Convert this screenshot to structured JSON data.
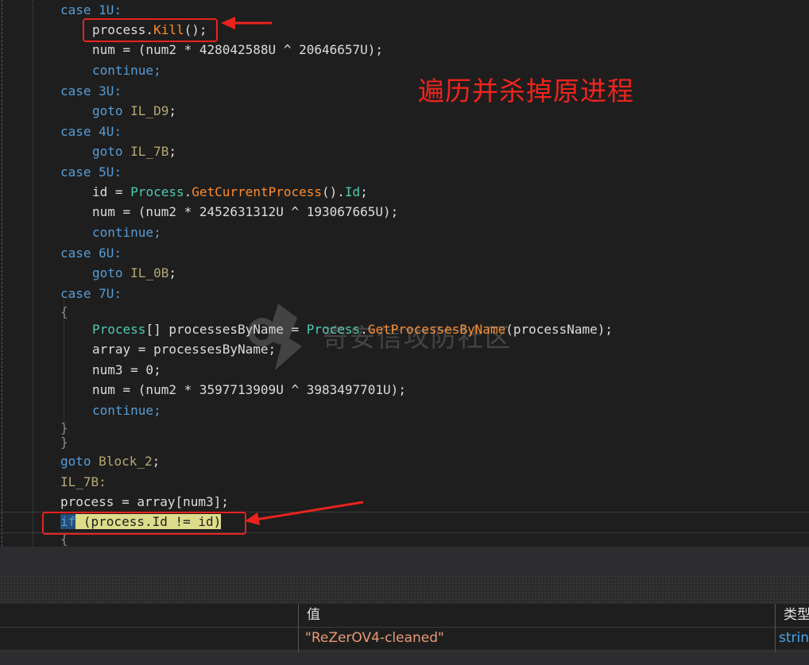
{
  "annotation": "遍历并杀掉原进程",
  "watermark": "奇安信攻防社区",
  "code": {
    "l1_case": "case",
    "l1_num": "1U:",
    "l2_obj": "process.",
    "l2_method": "Kill",
    "l2_rest": "();",
    "l3": "num = (num2 * 428042588U ^ 20646657U);",
    "l4": "continue;",
    "l5_case": "case",
    "l5_num": "3U:",
    "l6_goto": "goto",
    "l6_label": "IL_D9",
    "l6_semi": ";",
    "l7_case": "case",
    "l7_num": "4U:",
    "l8_goto": "goto",
    "l8_label": "IL_7B",
    "l8_semi": ";",
    "l9_case": "case",
    "l9_num": "5U:",
    "l10_a": "id = ",
    "l10_type": "Process",
    "l10_dot": ".",
    "l10_method": "GetCurrentProcess",
    "l10_paren": "().",
    "l10_prop": "Id",
    "l10_semi": ";",
    "l11": "num = (num2 * 2452631312U ^ 193067665U);",
    "l12": "continue;",
    "l13_case": "case",
    "l13_num": "6U:",
    "l14_goto": "goto",
    "l14_label": "IL_0B",
    "l14_semi": ";",
    "l15_case": "case",
    "l15_num": "7U:",
    "l16": "{",
    "l17_type": "Process",
    "l17_a": "[] processesByName = ",
    "l17_type2": "Process",
    "l17_dot": ".",
    "l17_method": "GetProcessesByName",
    "l17_rest": "(processName);",
    "l18": "array = processesByName;",
    "l19": "num3 = 0;",
    "l20": "num = (num2 * 3597713909U ^ 3983497701U);",
    "l21": "continue;",
    "l22": "}",
    "l23": "}",
    "l24_goto": "goto",
    "l24_label": "Block_2",
    "l24_semi": ";",
    "l25": "IL_7B:",
    "l26": "process = array[num3];",
    "l27_if": "if",
    "l27_cond": " (process.Id != id)",
    "l28": "{"
  },
  "watch": {
    "col_value": "值",
    "col_type": "类型",
    "value": "\"ReZerOV4-cleaned\"",
    "type": "strin"
  },
  "colors": {
    "annotation_red": "#f0241c",
    "keyword": "#569cd6",
    "type": "#4ec9b0",
    "method": "#ff8c2a"
  }
}
